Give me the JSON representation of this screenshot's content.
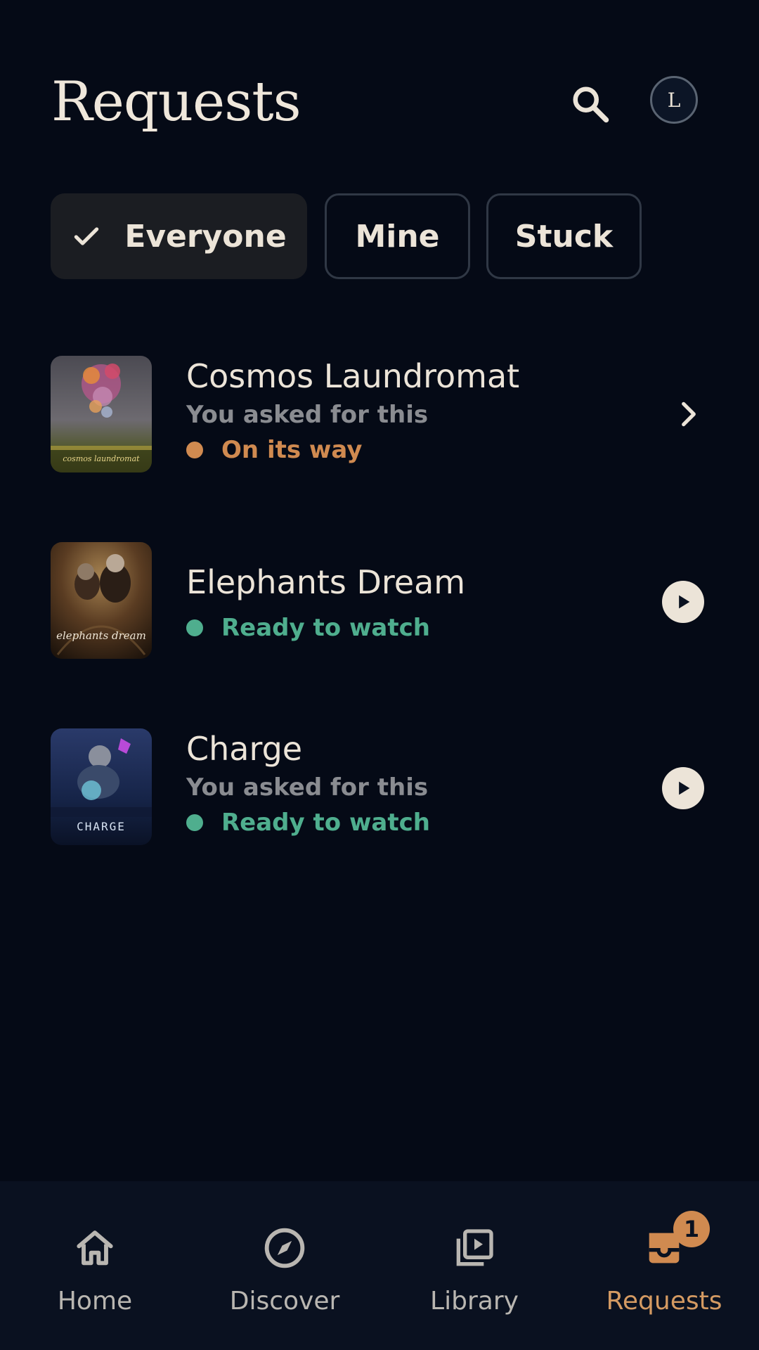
{
  "header": {
    "title": "Requests",
    "avatar_initial": "L"
  },
  "filters": [
    {
      "label": "Everyone",
      "selected": true
    },
    {
      "label": "Mine",
      "selected": false
    },
    {
      "label": "Stuck",
      "selected": false
    }
  ],
  "requests": [
    {
      "title": "Cosmos Laundromat",
      "subtitle": "You asked for this",
      "status": "On its way",
      "status_color": "#d08a50",
      "action": "chevron-right-icon",
      "poster_text": "cosmos laundromat"
    },
    {
      "title": "Elephants Dream",
      "subtitle": "",
      "status": "Ready to watch",
      "status_color": "#4fae8e",
      "action": "play-icon",
      "poster_text": "elephants dream"
    },
    {
      "title": "Charge",
      "subtitle": "You asked for this",
      "status": "Ready to watch",
      "status_color": "#4fae8e",
      "action": "play-icon",
      "poster_text": "CHARGE"
    }
  ],
  "nav": {
    "items": [
      {
        "label": "Home",
        "icon": "home-icon"
      },
      {
        "label": "Discover",
        "icon": "compass-icon"
      },
      {
        "label": "Library",
        "icon": "library-icon"
      },
      {
        "label": "Requests",
        "icon": "requests-icon",
        "active": true,
        "badge": "1"
      }
    ]
  },
  "colors": {
    "background": "#050a16",
    "accent": "#d08a50",
    "ready": "#4fae8e"
  }
}
